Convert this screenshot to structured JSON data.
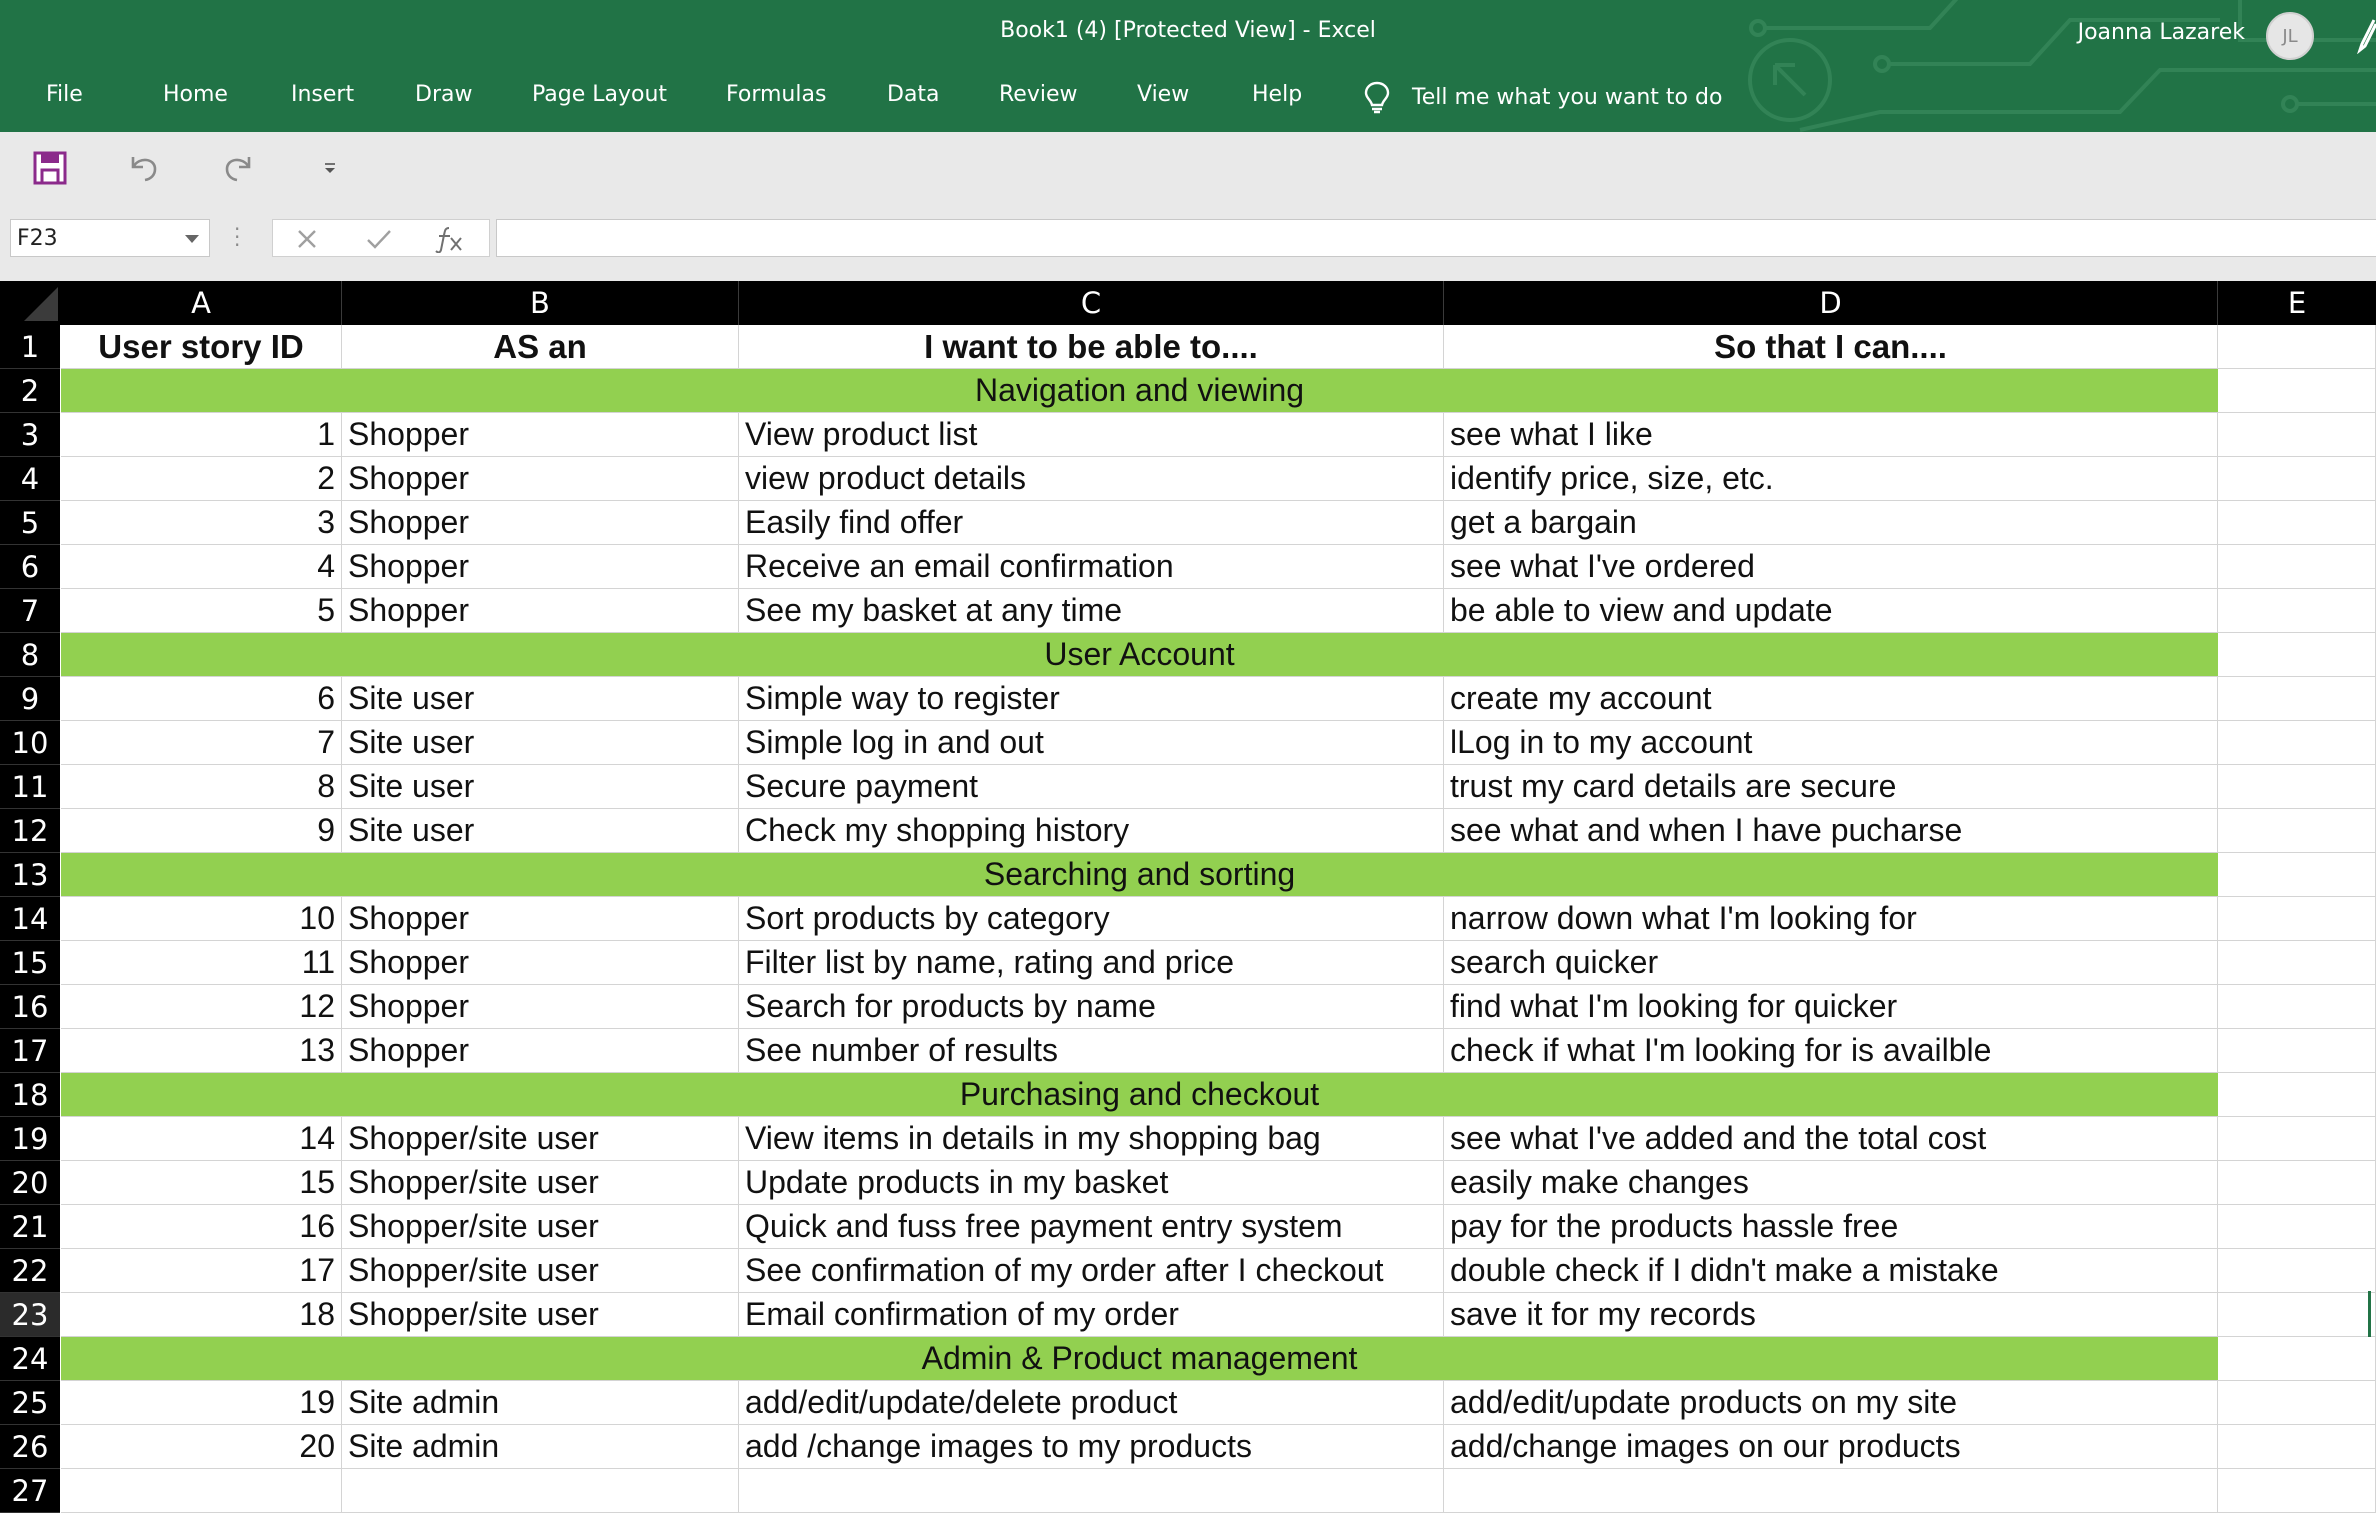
{
  "titlebar": {
    "document_title": "Book1 (4)  [Protected View]  -  Excel",
    "user_name": "Joanna Lazarek",
    "user_initials": "JL",
    "bg_color": "#217346"
  },
  "ribbon_tabs": [
    "File",
    "Home",
    "Insert",
    "Draw",
    "Page Layout",
    "Formulas",
    "Data",
    "Review",
    "View",
    "Help"
  ],
  "tell_me": "Tell me what you want to do",
  "quick_access": {
    "icons": [
      "save-icon",
      "undo-icon",
      "redo-icon",
      "customize-dropdown-icon"
    ]
  },
  "formula_bar": {
    "name_box": "F23",
    "formula": ""
  },
  "columns": [
    "A",
    "B",
    "C",
    "D",
    "E"
  ],
  "rows": [
    {
      "n": "1",
      "kind": "header",
      "a": "User story ID",
      "b": "AS an",
      "c": "I want to be able to....",
      "d": "So that I can...."
    },
    {
      "n": "2",
      "kind": "section",
      "label": "Navigation and viewing"
    },
    {
      "n": "3",
      "kind": "data",
      "a": "1",
      "b": "Shopper",
      "c": "View product list",
      "d": "see what I like"
    },
    {
      "n": "4",
      "kind": "data",
      "a": "2",
      "b": "Shopper",
      "c": "view product details",
      "d": "identify price, size, etc."
    },
    {
      "n": "5",
      "kind": "data",
      "a": "3",
      "b": "Shopper",
      "c": "Easily find offer",
      "d": "get a bargain"
    },
    {
      "n": "6",
      "kind": "data",
      "a": "4",
      "b": "Shopper",
      "c": "Receive an email confirmation",
      "d": "see what I've ordered"
    },
    {
      "n": "7",
      "kind": "data",
      "a": "5",
      "b": "Shopper",
      "c": "See my basket at any time",
      "d": "be able to view and update"
    },
    {
      "n": "8",
      "kind": "section",
      "label": "User Account"
    },
    {
      "n": "9",
      "kind": "data",
      "a": "6",
      "b": "Site user",
      "c": "Simple way to  register",
      "d": "create my account"
    },
    {
      "n": "10",
      "kind": "data",
      "a": "7",
      "b": "Site user",
      "c": "Simple log in and out",
      "d": "lLog in to my account"
    },
    {
      "n": "11",
      "kind": "data",
      "a": "8",
      "b": "Site user",
      "c": "Secure payment",
      "d": "trust my card details are secure"
    },
    {
      "n": "12",
      "kind": "data",
      "a": "9",
      "b": "Site user",
      "c": "Check my shopping history",
      "d": "see what and when I have pucharse"
    },
    {
      "n": "13",
      "kind": "section",
      "label": "Searching and sorting"
    },
    {
      "n": "14",
      "kind": "data",
      "a": "10",
      "b": "Shopper",
      "c": "Sort products by category",
      "d": "narrow down what I'm looking for"
    },
    {
      "n": "15",
      "kind": "data",
      "a": "11",
      "b": "Shopper",
      "c": "Filter list by name, rating and price",
      "d": "search quicker"
    },
    {
      "n": "16",
      "kind": "data",
      "a": "12",
      "b": "Shopper",
      "c": "Search for products by name",
      "d": "find what I'm looking for quicker"
    },
    {
      "n": "17",
      "kind": "data",
      "a": "13",
      "b": "Shopper",
      "c": "See number of results",
      "d": "check if what I'm looking for is availble"
    },
    {
      "n": "18",
      "kind": "section",
      "label": "Purchasing and checkout"
    },
    {
      "n": "19",
      "kind": "data",
      "a": "14",
      "b": "Shopper/site user",
      "c": "View items in details in my shopping bag",
      "d": "see what I've added and the total cost"
    },
    {
      "n": "20",
      "kind": "data",
      "a": "15",
      "b": "Shopper/site user",
      "c": "Update products in my basket",
      "d": "easily make changes"
    },
    {
      "n": "21",
      "kind": "data",
      "a": "16",
      "b": "Shopper/site user",
      "c": "Quick and fuss free payment entry system",
      "d": "pay for the products hassle free"
    },
    {
      "n": "22",
      "kind": "data",
      "a": "17",
      "b": "Shopper/site user",
      "c": "See confirmation of my order after I checkout",
      "d": "double check if I didn't make a mistake"
    },
    {
      "n": "23",
      "kind": "data",
      "a": "18",
      "b": "Shopper/site user",
      "c": "Email confirmation of my order",
      "d": "save it for my records",
      "active": true
    },
    {
      "n": "24",
      "kind": "section",
      "label": "Admin & Product management"
    },
    {
      "n": "25",
      "kind": "data",
      "a": "19",
      "b": "Site admin",
      "c": "add/edit/update/delete product",
      "d": "add/edit/update products on my site"
    },
    {
      "n": "26",
      "kind": "data",
      "a": "20",
      "b": "Site admin",
      "c": "add /change images to my products",
      "d": "add/change images on our products"
    },
    {
      "n": "27",
      "kind": "data",
      "a": "",
      "b": "",
      "c": "",
      "d": ""
    }
  ],
  "colors": {
    "section_fill": "#92d050",
    "excel_green": "#217346"
  }
}
